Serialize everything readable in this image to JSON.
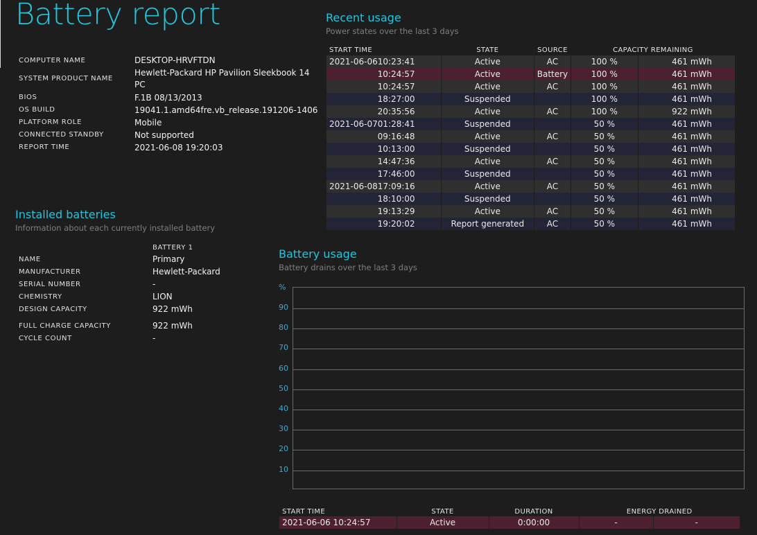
{
  "report_title": "Battery report",
  "system_info": [
    {
      "label": "COMPUTER NAME",
      "value": "DESKTOP-HRVFTDN"
    },
    {
      "label": "SYSTEM PRODUCT NAME",
      "value": "Hewlett-Packard HP Pavilion Sleekbook 14",
      "value2": "PC"
    },
    {
      "label": "BIOS",
      "value": "F.1B 08/13/2013"
    },
    {
      "label": "OS BUILD",
      "value": "19041.1.amd64fre.vb_release.191206-1406"
    },
    {
      "label": "PLATFORM ROLE",
      "value": "Mobile"
    },
    {
      "label": "CONNECTED STANDBY",
      "value": "Not supported"
    },
    {
      "label": "REPORT TIME",
      "value": "2021-06-08  19:20:03"
    }
  ],
  "installed_batteries": {
    "title": "Installed batteries",
    "subtitle": "Information about each currently installed battery",
    "column": "BATTERY 1",
    "rows": [
      {
        "label": "NAME",
        "value": "Primary"
      },
      {
        "label": "MANUFACTURER",
        "value": "Hewlett-Packard"
      },
      {
        "label": "SERIAL NUMBER",
        "value": "-"
      },
      {
        "label": "CHEMISTRY",
        "value": "LION"
      },
      {
        "label": "DESIGN CAPACITY",
        "value": "922 mWh"
      },
      {
        "label": "FULL CHARGE CAPACITY",
        "value": "922 mWh"
      },
      {
        "label": "CYCLE COUNT",
        "value": "-"
      }
    ]
  },
  "recent_usage": {
    "title": "Recent usage",
    "subtitle": "Power states over the last 3 days",
    "headers": [
      "START TIME",
      "STATE",
      "SOURCE",
      "CAPACITY REMAINING"
    ],
    "rows": [
      {
        "date": "2021-06-06",
        "time": "10:23:41",
        "state": "Active",
        "source": "AC",
        "pct": "100 %",
        "cap": "461 mWh"
      },
      {
        "date": "",
        "time": "10:24:57",
        "state": "Active",
        "source": "Battery",
        "pct": "100 %",
        "cap": "461 mWh"
      },
      {
        "date": "",
        "time": "10:24:57",
        "state": "Active",
        "source": "AC",
        "pct": "100 %",
        "cap": "461 mWh"
      },
      {
        "date": "",
        "time": "18:27:00",
        "state": "Suspended",
        "source": "",
        "pct": "100 %",
        "cap": "461 mWh"
      },
      {
        "date": "",
        "time": "20:35:56",
        "state": "Active",
        "source": "AC",
        "pct": "100 %",
        "cap": "922 mWh"
      },
      {
        "date": "2021-06-07",
        "time": "01:28:41",
        "state": "Suspended",
        "source": "",
        "pct": "50 %",
        "cap": "461 mWh"
      },
      {
        "date": "",
        "time": "09:16:48",
        "state": "Active",
        "source": "AC",
        "pct": "50 %",
        "cap": "461 mWh"
      },
      {
        "date": "",
        "time": "10:13:00",
        "state": "Suspended",
        "source": "",
        "pct": "50 %",
        "cap": "461 mWh"
      },
      {
        "date": "",
        "time": "14:47:36",
        "state": "Active",
        "source": "AC",
        "pct": "50 %",
        "cap": "461 mWh"
      },
      {
        "date": "",
        "time": "17:46:00",
        "state": "Suspended",
        "source": "",
        "pct": "50 %",
        "cap": "461 mWh"
      },
      {
        "date": "2021-06-08",
        "time": "17:09:16",
        "state": "Active",
        "source": "AC",
        "pct": "50 %",
        "cap": "461 mWh"
      },
      {
        "date": "",
        "time": "18:10:00",
        "state": "Suspended",
        "source": "",
        "pct": "50 %",
        "cap": "461 mWh"
      },
      {
        "date": "",
        "time": "19:13:29",
        "state": "Active",
        "source": "AC",
        "pct": "50 %",
        "cap": "461 mWh"
      },
      {
        "date": "",
        "time": "19:20:02",
        "state": "Report generated",
        "source": "AC",
        "pct": "50 %",
        "cap": "461 mWh"
      }
    ]
  },
  "battery_usage": {
    "title": "Battery usage",
    "subtitle": "Battery drains over the last 3 days",
    "y_unit": "%",
    "y_ticks": [
      "90",
      "80",
      "70",
      "60",
      "50",
      "40",
      "30",
      "20",
      "10"
    ],
    "headers": [
      "START TIME",
      "STATE",
      "DURATION",
      "ENERGY DRAINED"
    ],
    "row": {
      "start": "2021-06-06  10:24:57",
      "state": "Active",
      "duration": "0:00:00",
      "pct": "-",
      "energy": "-"
    }
  },
  "colors": {
    "accent": "#20c6dd",
    "battery_row": "#4c2030",
    "odd_row": "#232436",
    "even_row": "#2f2f2f",
    "axis_labels": "#4aa3c7"
  }
}
